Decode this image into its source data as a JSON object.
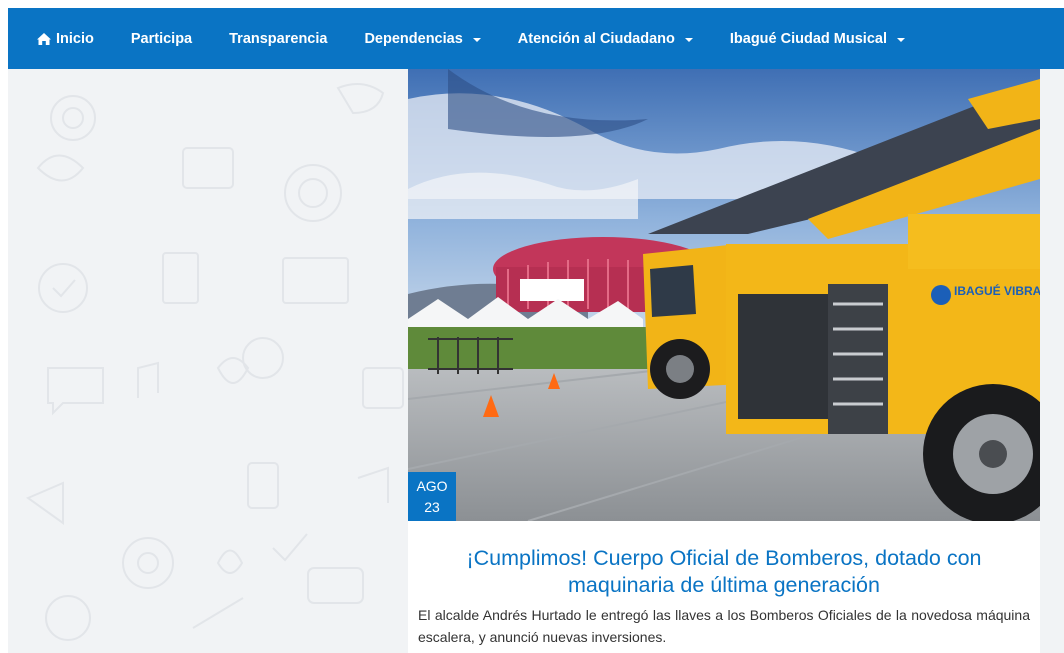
{
  "nav": {
    "items": [
      {
        "label": "Inicio",
        "icon": "home-icon",
        "dropdown": false
      },
      {
        "label": "Participa",
        "dropdown": false
      },
      {
        "label": "Transparencia",
        "dropdown": false
      },
      {
        "label": "Dependencias",
        "dropdown": true
      },
      {
        "label": "Atención al Ciudadano",
        "dropdown": true
      },
      {
        "label": "Ibagué Ciudad Musical",
        "dropdown": true
      }
    ]
  },
  "article": {
    "date_month": "AGO",
    "date_day": "23",
    "title": "¡Cumplimos! Cuerpo Oficial de Bomberos, dotado con maquinaria de última generación",
    "summary": "El alcalde Andrés Hurtado le entregó las llaves a los Bomberos Oficiales de la novedosa máquina escalera, y anunció nuevas inversiones.",
    "image_alt": "fire-truck-photo",
    "truck_logo": "IBAGUÉ VIBRA",
    "banner_text": "IBAGUÉ VIBRA"
  },
  "colors": {
    "nav_bg": "#0a74c4",
    "accent": "#0a74c4",
    "page_bg": "#f1f3f5"
  }
}
